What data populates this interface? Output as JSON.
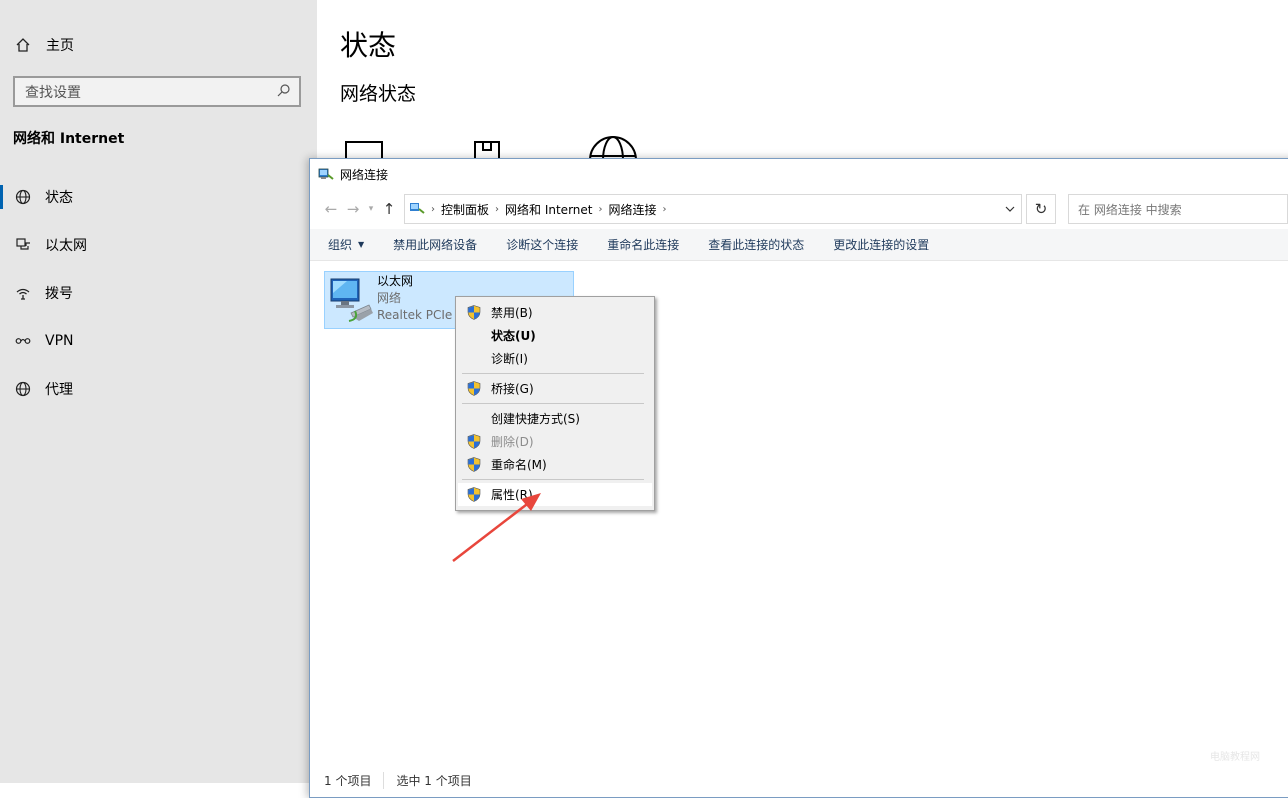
{
  "settings": {
    "home_label": "主页",
    "search_placeholder": "查找设置",
    "section_title": "网络和 Internet",
    "nav": [
      {
        "label": "状态",
        "icon": "globe-icon",
        "active": true
      },
      {
        "label": "以太网",
        "icon": "ethernet-icon"
      },
      {
        "label": "拨号",
        "icon": "dialup-icon"
      },
      {
        "label": "VPN",
        "icon": "vpn-icon"
      },
      {
        "label": "代理",
        "icon": "proxy-globe-icon"
      }
    ],
    "page_title": "状态",
    "page_subtitle": "网络状态"
  },
  "explorer": {
    "title": "网络连接",
    "breadcrumb": [
      "控制面板",
      "网络和 Internet",
      "网络连接"
    ],
    "search_placeholder": "在 网络连接 中搜索",
    "toolbar": {
      "organize": "组织",
      "disable": "禁用此网络设备",
      "diagnose": "诊断这个连接",
      "rename": "重命名此连接",
      "view_status": "查看此连接的状态",
      "change_settings": "更改此连接的设置"
    },
    "connection": {
      "name": "以太网",
      "type": "网络",
      "adapter": "Realtek PCIe"
    },
    "status": {
      "count": "1 个项目",
      "selected": "选中 1 个项目"
    }
  },
  "context_menu": {
    "disable": "禁用(B)",
    "status": "状态(U)",
    "diagnose": "诊断(I)",
    "bridge": "桥接(G)",
    "shortcut": "创建快捷方式(S)",
    "delete": "删除(D)",
    "rename": "重命名(M)",
    "properties": "属性(R)"
  },
  "watermark": "电脑教程网",
  "colors": {
    "accent": "#0063b1",
    "selection": "#cce8ff",
    "arrow": "#e8463c"
  }
}
